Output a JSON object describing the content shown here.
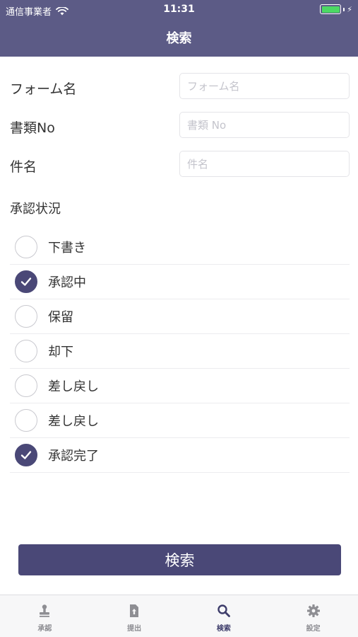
{
  "status_bar": {
    "carrier": "通信事業者",
    "time": "11:31"
  },
  "nav": {
    "title": "検索"
  },
  "form": {
    "form_name": {
      "label": "フォーム名",
      "placeholder": "フォーム名",
      "value": ""
    },
    "doc_no": {
      "label": "書類No",
      "placeholder": "書類 No",
      "value": ""
    },
    "subject": {
      "label": "件名",
      "placeholder": "件名",
      "value": ""
    }
  },
  "approval_status": {
    "label": "承認状況",
    "options": [
      {
        "label": "下書き",
        "checked": false
      },
      {
        "label": "承認中",
        "checked": true
      },
      {
        "label": "保留",
        "checked": false
      },
      {
        "label": "却下",
        "checked": false
      },
      {
        "label": "差し戻し",
        "checked": false
      },
      {
        "label": "差し戻し",
        "checked": false
      },
      {
        "label": "承認完了",
        "checked": true
      }
    ]
  },
  "search_button": {
    "label": "検索"
  },
  "tab_bar": {
    "tabs": [
      {
        "label": "承認",
        "icon": "stamp-icon",
        "active": false
      },
      {
        "label": "提出",
        "icon": "upload-document-icon",
        "active": false
      },
      {
        "label": "検索",
        "icon": "search-icon",
        "active": true
      },
      {
        "label": "設定",
        "icon": "gear-icon",
        "active": false
      }
    ]
  },
  "colors": {
    "header_bg": "#5c5b86",
    "accent": "#4a4877",
    "active_tab": "#3e3d6b",
    "inactive_tab": "#8e8e93",
    "battery": "#4cd964"
  }
}
